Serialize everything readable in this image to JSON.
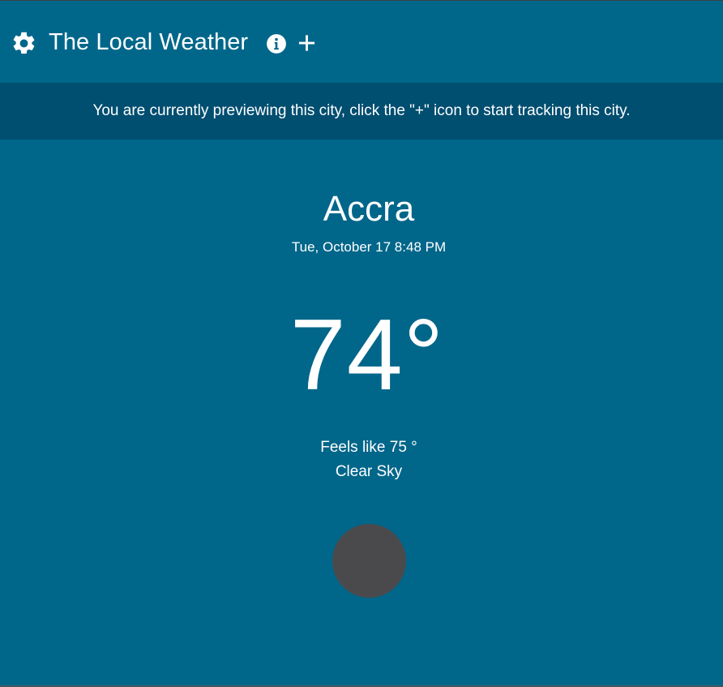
{
  "header": {
    "title": "The Local Weather",
    "icons": {
      "settings": "gear-icon",
      "info": "info-icon",
      "add": "plus-icon"
    }
  },
  "banner": {
    "message": "You are currently previewing this city, click the \"+\" icon to start tracking this city."
  },
  "weather": {
    "city": "Accra",
    "datetime": "Tue, October 17 8:48 PM",
    "temperature": "74°",
    "feels_like": "Feels like 75 °",
    "condition": "Clear Sky",
    "icon": "weather-condition-icon"
  },
  "colors": {
    "background": "#00678a",
    "banner": "#004e70",
    "text": "#ffffff",
    "weather_icon_placeholder": "#4a4a4d"
  }
}
